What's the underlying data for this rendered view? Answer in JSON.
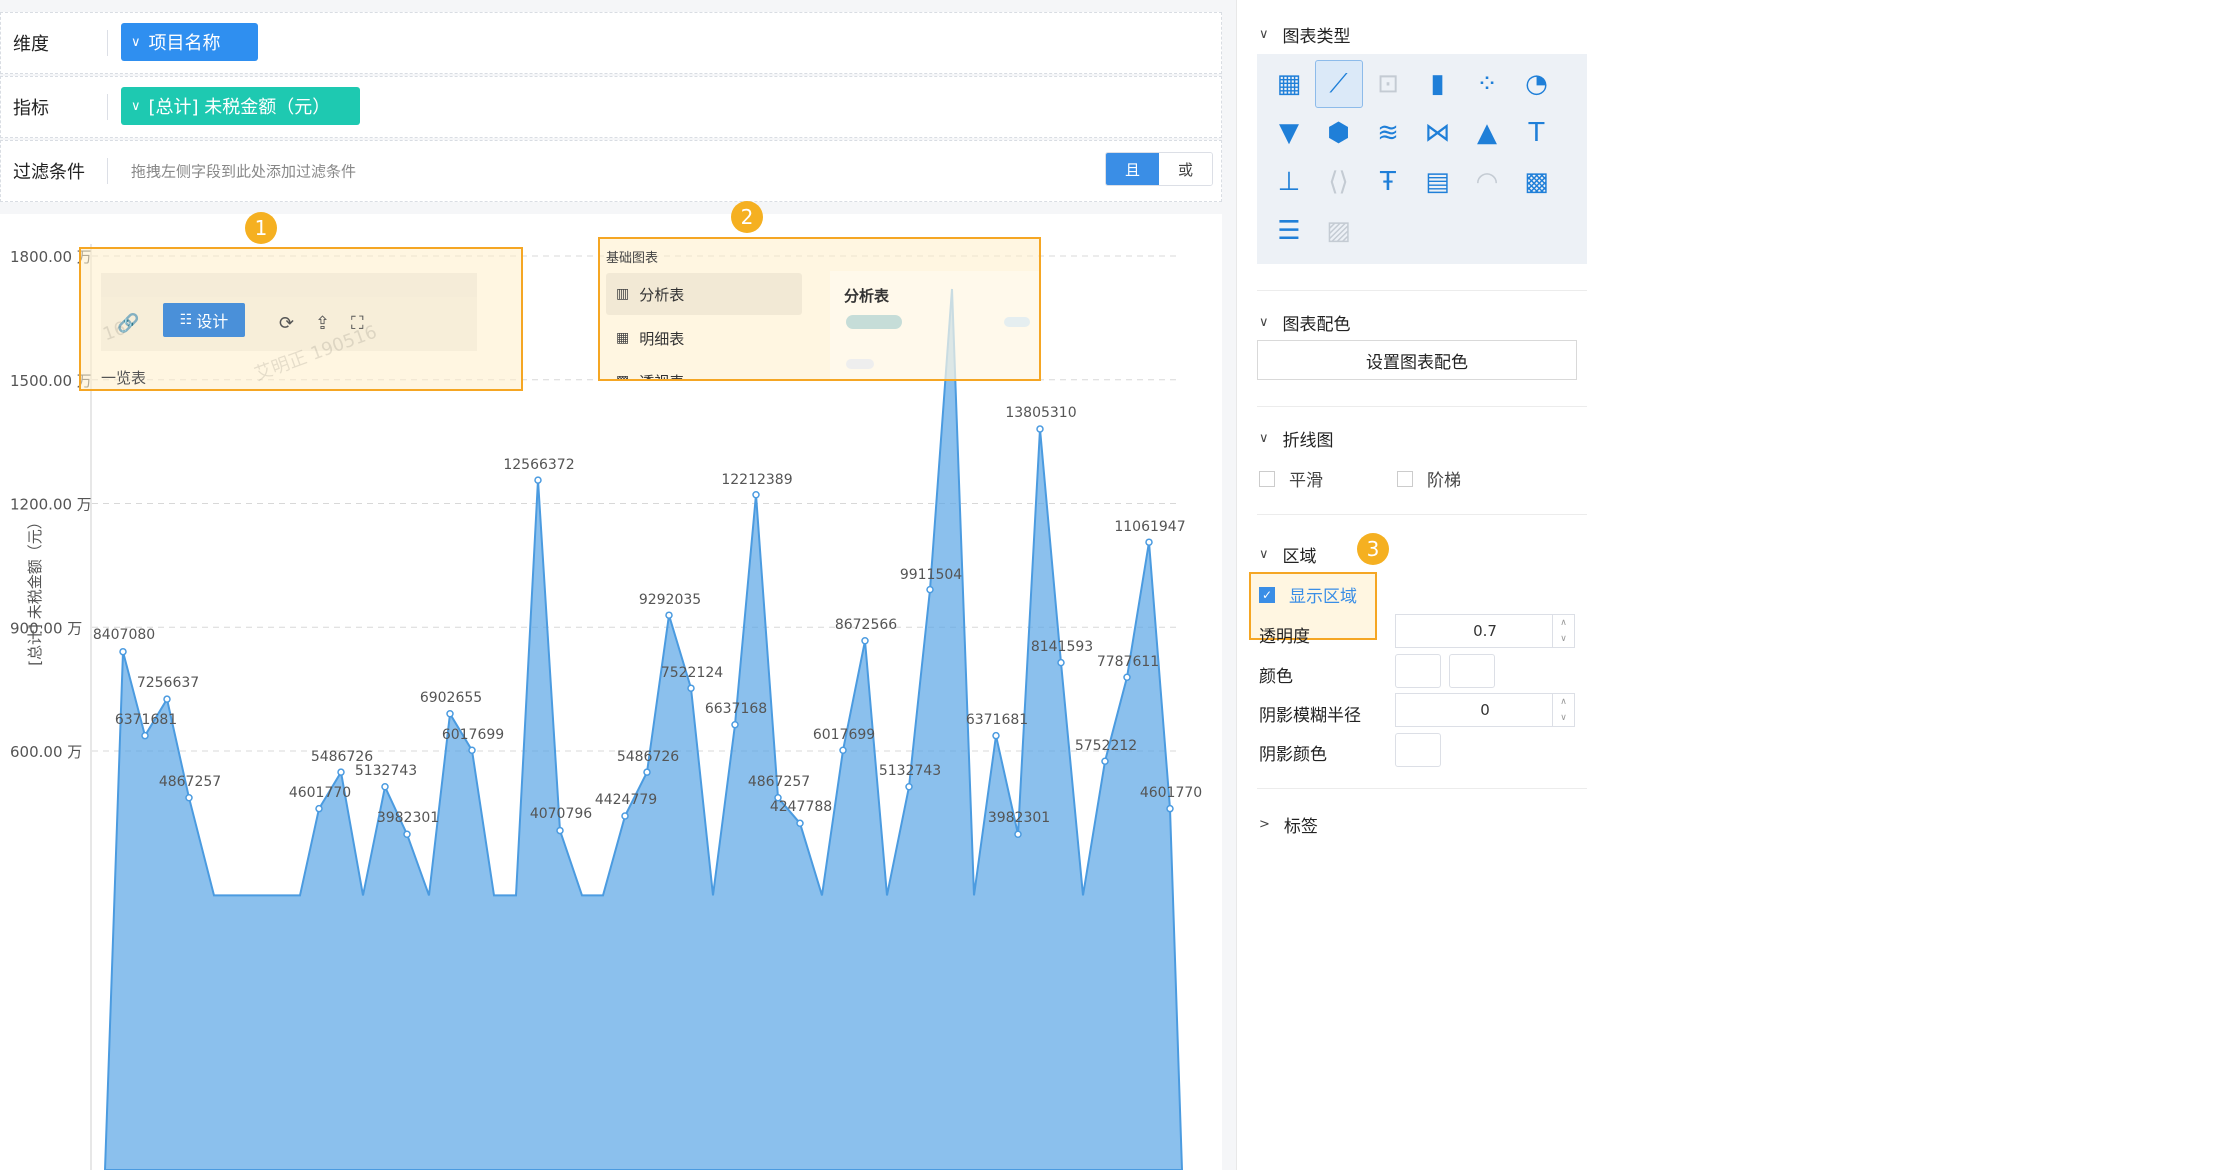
{
  "query": {
    "dimension": {
      "label": "维度",
      "pill": "项目名称",
      "pill_color": "#2f8ff0"
    },
    "metric": {
      "label": "指标",
      "pill": "[总计] 未税金额（元）",
      "pill_color": "#1ec9b1"
    },
    "filter": {
      "label": "过滤条件",
      "hint": "拖拽左侧字段到此处添加过滤条件",
      "and_label": "且",
      "or_label": "或"
    }
  },
  "callouts": {
    "one": "1",
    "two": "2",
    "three": "3"
  },
  "popover1": {
    "design_label": "设计",
    "bottom_text": "一览表",
    "watermark": "艾明正 190516",
    "watermark_small": "16"
  },
  "popover2": {
    "category": "基础图表",
    "items": [
      "分析表",
      "明细表",
      "透视表"
    ],
    "card_title": "分析表"
  },
  "chart_data": {
    "type": "area",
    "ylabel": "[总计] 未税金额（元）",
    "yticks": [
      "1800.00 万",
      "1500.00 万",
      "1200.00 万",
      "900.00 万",
      "600.00 万"
    ],
    "ytick_values": [
      18000000,
      15000000,
      12000000,
      9000000,
      6000000
    ],
    "area_opacity": 0.7,
    "color": "#5aa5e6",
    "points": [
      {
        "x": 123,
        "v": 8407080,
        "label": "8407080",
        "lx": 124,
        "ly": 634,
        "showpt": true
      },
      {
        "x": 145,
        "v": 6371681,
        "label": "6371681",
        "lx": 146,
        "ly": 719,
        "showpt": true
      },
      {
        "x": 167,
        "v": 7256637,
        "label": "7256637",
        "lx": 168,
        "ly": 682,
        "showpt": true
      },
      {
        "x": 189,
        "v": 4867257,
        "label": "4867257",
        "lx": 190,
        "ly": 781,
        "showpt": true
      },
      {
        "x": 214,
        "v": 2500000,
        "label": "",
        "showpt": false
      },
      {
        "x": 300,
        "v": 2500000,
        "label": "",
        "showpt": false
      },
      {
        "x": 319,
        "v": 4601770,
        "label": "4601770",
        "lx": 320,
        "ly": 792,
        "showpt": true
      },
      {
        "x": 341,
        "v": 5486726,
        "label": "5486726",
        "lx": 342,
        "ly": 756,
        "showpt": true
      },
      {
        "x": 363,
        "v": 2500000,
        "label": "",
        "showpt": false
      },
      {
        "x": 385,
        "v": 5132743,
        "label": "5132743",
        "lx": 386,
        "ly": 770,
        "showpt": true
      },
      {
        "x": 407,
        "v": 3982301,
        "label": "3982301",
        "lx": 408,
        "ly": 817,
        "showpt": true
      },
      {
        "x": 429,
        "v": 2500000,
        "label": "",
        "showpt": false
      },
      {
        "x": 450,
        "v": 6902655,
        "label": "6902655",
        "lx": 451,
        "ly": 697,
        "showpt": true
      },
      {
        "x": 472,
        "v": 6017699,
        "label": "6017699",
        "lx": 473,
        "ly": 734,
        "showpt": true
      },
      {
        "x": 494,
        "v": 2500000,
        "label": "",
        "showpt": false
      },
      {
        "x": 516,
        "v": 2500000,
        "label": "",
        "showpt": false
      },
      {
        "x": 538,
        "v": 12566372,
        "label": "12566372",
        "lx": 539,
        "ly": 464,
        "showpt": true
      },
      {
        "x": 560,
        "v": 4070796,
        "label": "4070796",
        "lx": 561,
        "ly": 813,
        "showpt": true
      },
      {
        "x": 582,
        "v": 2500000,
        "label": "",
        "showpt": false
      },
      {
        "x": 603,
        "v": 2500000,
        "label": "",
        "showpt": false
      },
      {
        "x": 625,
        "v": 4424779,
        "label": "4424779",
        "lx": 626,
        "ly": 799,
        "showpt": true
      },
      {
        "x": 647,
        "v": 5486726,
        "label": "5486726",
        "lx": 648,
        "ly": 756,
        "showpt": true
      },
      {
        "x": 669,
        "v": 9292035,
        "label": "9292035",
        "lx": 670,
        "ly": 599,
        "showpt": true
      },
      {
        "x": 691,
        "v": 7522124,
        "label": "7522124",
        "lx": 692,
        "ly": 672,
        "showpt": true
      },
      {
        "x": 713,
        "v": 2500000,
        "label": "",
        "showpt": false
      },
      {
        "x": 735,
        "v": 6637168,
        "label": "6637168",
        "lx": 736,
        "ly": 708,
        "showpt": true
      },
      {
        "x": 756,
        "v": 12212389,
        "label": "12212389",
        "lx": 757,
        "ly": 479,
        "showpt": true
      },
      {
        "x": 778,
        "v": 4867257,
        "label": "4867257",
        "lx": 779,
        "ly": 781,
        "showpt": true
      },
      {
        "x": 800,
        "v": 4247788,
        "label": "4247788",
        "lx": 801,
        "ly": 806,
        "showpt": true
      },
      {
        "x": 822,
        "v": 2500000,
        "label": "",
        "showpt": false
      },
      {
        "x": 843,
        "v": 6017699,
        "label": "6017699",
        "lx": 844,
        "ly": 734,
        "showpt": true
      },
      {
        "x": 865,
        "v": 8672566,
        "label": "8672566",
        "lx": 866,
        "ly": 624,
        "showpt": true
      },
      {
        "x": 887,
        "v": 2500000,
        "label": "",
        "showpt": false
      },
      {
        "x": 909,
        "v": 5132743,
        "label": "5132743",
        "lx": 910,
        "ly": 770,
        "showpt": true
      },
      {
        "x": 930,
        "v": 9911504,
        "label": "9911504",
        "lx": 931,
        "ly": 574,
        "showpt": true
      },
      {
        "x": 952,
        "v": 17200000,
        "label": "",
        "showpt": false
      },
      {
        "x": 974,
        "v": 2500000,
        "label": "",
        "showpt": false
      },
      {
        "x": 996,
        "v": 6371681,
        "label": "6371681",
        "lx": 997,
        "ly": 719,
        "showpt": true
      },
      {
        "x": 1018,
        "v": 3982301,
        "label": "3982301",
        "lx": 1019,
        "ly": 817,
        "showpt": true
      },
      {
        "x": 1040,
        "v": 13805310,
        "label": "13805310",
        "lx": 1041,
        "ly": 412,
        "showpt": true
      },
      {
        "x": 1061,
        "v": 8141593,
        "label": "8141593",
        "lx": 1062,
        "ly": 646,
        "showpt": true
      },
      {
        "x": 1083,
        "v": 2500000,
        "label": "",
        "showpt": false
      },
      {
        "x": 1105,
        "v": 5752212,
        "label": "5752212",
        "lx": 1106,
        "ly": 745,
        "showpt": true
      },
      {
        "x": 1127,
        "v": 7787611,
        "label": "7787611",
        "lx": 1128,
        "ly": 661,
        "showpt": true
      },
      {
        "x": 1149,
        "v": 11061947,
        "label": "11061947",
        "lx": 1150,
        "ly": 526,
        "showpt": true
      },
      {
        "x": 1170,
        "v": 4601770,
        "label": "4601770",
        "lx": 1171,
        "ly": 792,
        "showpt": true
      }
    ]
  },
  "sidebar": {
    "chart_type": {
      "title": "图表类型",
      "icons": [
        {
          "name": "table-chart-icon",
          "glyph": "▦",
          "sel": false,
          "dis": false
        },
        {
          "name": "line-chart-icon",
          "glyph": "⟋",
          "sel": true,
          "dis": false
        },
        {
          "name": "kpi-card-icon",
          "glyph": "⊡",
          "sel": false,
          "dis": true
        },
        {
          "name": "bar-chart-icon",
          "glyph": "▮",
          "sel": false,
          "dis": false
        },
        {
          "name": "scatter-chart-icon",
          "glyph": "⁘",
          "sel": false,
          "dis": false
        },
        {
          "name": "pie-chart-icon",
          "glyph": "◔",
          "sel": false,
          "dis": false
        },
        {
          "name": "funnel-chart-icon",
          "glyph": "▼",
          "sel": false,
          "dis": false
        },
        {
          "name": "radar-chart-icon",
          "glyph": "⬢",
          "sel": false,
          "dis": false
        },
        {
          "name": "sankey-chart-icon",
          "glyph": "≋",
          "sel": false,
          "dis": false
        },
        {
          "name": "parallel-chart-icon",
          "glyph": "⋈",
          "sel": false,
          "dis": false
        },
        {
          "name": "map-chart-icon",
          "glyph": "▲",
          "sel": false,
          "dis": false
        },
        {
          "name": "word-cloud-icon",
          "glyph": "T",
          "sel": false,
          "dis": false
        },
        {
          "name": "waterfall-chart-icon",
          "glyph": "⊥",
          "sel": false,
          "dis": false
        },
        {
          "name": "embed-code-icon",
          "glyph": "⟨⟩",
          "sel": false,
          "dis": true
        },
        {
          "name": "rich-text-icon",
          "glyph": "Ŧ",
          "sel": false,
          "dis": false
        },
        {
          "name": "combo-chart-icon",
          "glyph": "▤",
          "sel": false,
          "dis": false
        },
        {
          "name": "gauge-chart-icon",
          "glyph": "◠",
          "sel": false,
          "dis": true
        },
        {
          "name": "grid-table-icon",
          "glyph": "▩",
          "sel": false,
          "dis": false
        },
        {
          "name": "rank-list-icon",
          "glyph": "☰",
          "sel": false,
          "dis": false
        },
        {
          "name": "image-widget-icon",
          "glyph": "▨",
          "sel": false,
          "dis": true
        }
      ]
    },
    "color": {
      "title": "图表配色",
      "button": "设置图表配色"
    },
    "line": {
      "title": "折线图",
      "smooth": "平滑",
      "step": "阶梯"
    },
    "area": {
      "title": "区域",
      "show_area": "显示区域",
      "opacity_label": "透明度",
      "opacity_value": "0.7",
      "color_label": "颜色",
      "blur_label": "阴影模糊半径",
      "blur_value": "0",
      "shadow_color_label": "阴影颜色"
    },
    "next_section": "标签"
  }
}
